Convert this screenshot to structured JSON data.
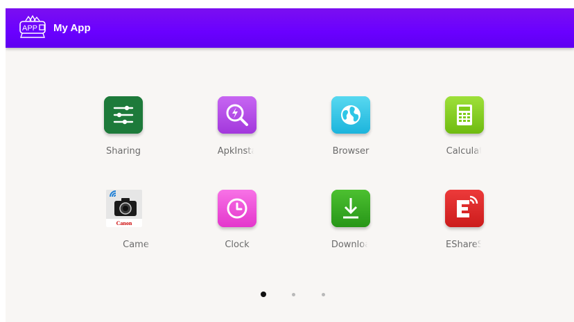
{
  "app_bar": {
    "title": "My App",
    "logo_text": "APP",
    "color": "#6a00ff"
  },
  "apps": [
    {
      "label": "Sharing",
      "icon": "sliders-icon",
      "color": "#1d7a3a"
    },
    {
      "label": "ApkInsta",
      "icon": "search-bolt-icon",
      "color": "#b546e8"
    },
    {
      "label": "Browser",
      "icon": "globe-icon",
      "color": "#2ec6e6"
    },
    {
      "label": "Calculat",
      "icon": "calculator-icon",
      "color": "#7fcc1a"
    },
    {
      "label": "Came",
      "icon": "camera-icon",
      "color": "#e8e8e8",
      "brand": "Canon"
    },
    {
      "label": "Clock",
      "icon": "clock-icon",
      "color": "#f04ad8"
    },
    {
      "label": "Downloa",
      "icon": "download-icon",
      "color": "#32a820"
    },
    {
      "label": "EShareS",
      "icon": "eshare-icon",
      "color": "#dd2626"
    }
  ],
  "pager": {
    "pages": 3,
    "current": 1
  }
}
